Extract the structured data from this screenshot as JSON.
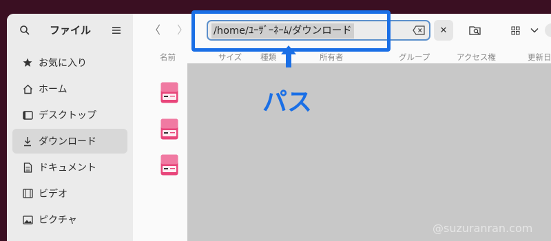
{
  "sidebar": {
    "title": "ファイル",
    "items": [
      {
        "label": "お気に入り",
        "icon": "star-icon"
      },
      {
        "label": "ホーム",
        "icon": "home-icon"
      },
      {
        "label": "デスクトップ",
        "icon": "desktop-icon"
      },
      {
        "label": "ダウンロード",
        "icon": "download-icon",
        "active": true
      },
      {
        "label": "ドキュメント",
        "icon": "document-icon"
      },
      {
        "label": "ビデオ",
        "icon": "video-icon"
      },
      {
        "label": "ピクチャ",
        "icon": "picture-icon"
      }
    ]
  },
  "toolbar": {
    "path": "/home/ﾕｰｻﾞｰﾈｰﾑ/ダウンロード",
    "close_glyph": "✕"
  },
  "columns": [
    "名前",
    "サイズ",
    "種類",
    "所有者",
    "グループ",
    "アクセス権",
    "更新日"
  ],
  "files": [
    {
      "name": "…"
    },
    {
      "name": "…"
    },
    {
      "name": "…"
    }
  ],
  "annotation": {
    "label": "パス",
    "color": "#1a6fe6"
  },
  "watermark": "@suzuranran.com"
}
